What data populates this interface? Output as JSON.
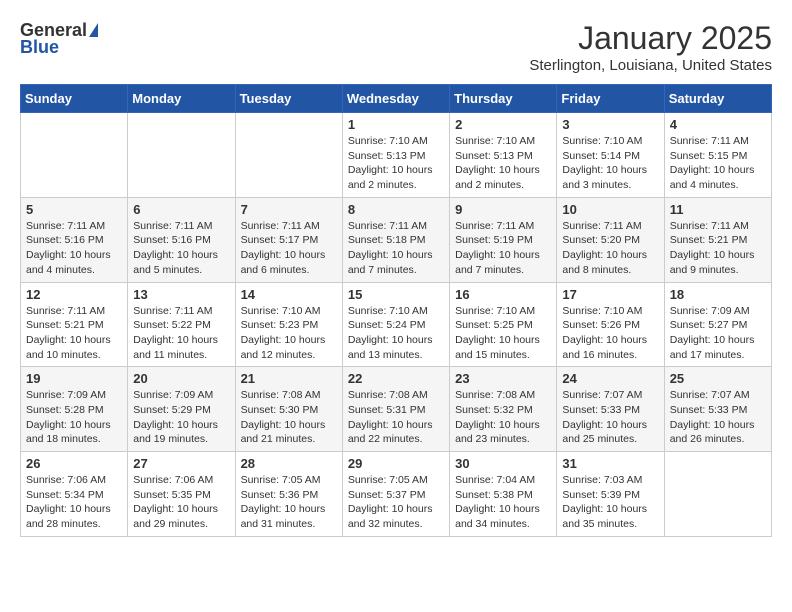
{
  "header": {
    "logo_general": "General",
    "logo_blue": "Blue",
    "month_title": "January 2025",
    "location": "Sterlington, Louisiana, United States"
  },
  "days_of_week": [
    "Sunday",
    "Monday",
    "Tuesday",
    "Wednesday",
    "Thursday",
    "Friday",
    "Saturday"
  ],
  "weeks": [
    [
      {
        "day": "",
        "info": ""
      },
      {
        "day": "",
        "info": ""
      },
      {
        "day": "",
        "info": ""
      },
      {
        "day": "1",
        "info": "Sunrise: 7:10 AM\nSunset: 5:13 PM\nDaylight: 10 hours\nand 2 minutes."
      },
      {
        "day": "2",
        "info": "Sunrise: 7:10 AM\nSunset: 5:13 PM\nDaylight: 10 hours\nand 2 minutes."
      },
      {
        "day": "3",
        "info": "Sunrise: 7:10 AM\nSunset: 5:14 PM\nDaylight: 10 hours\nand 3 minutes."
      },
      {
        "day": "4",
        "info": "Sunrise: 7:11 AM\nSunset: 5:15 PM\nDaylight: 10 hours\nand 4 minutes."
      }
    ],
    [
      {
        "day": "5",
        "info": "Sunrise: 7:11 AM\nSunset: 5:16 PM\nDaylight: 10 hours\nand 4 minutes."
      },
      {
        "day": "6",
        "info": "Sunrise: 7:11 AM\nSunset: 5:16 PM\nDaylight: 10 hours\nand 5 minutes."
      },
      {
        "day": "7",
        "info": "Sunrise: 7:11 AM\nSunset: 5:17 PM\nDaylight: 10 hours\nand 6 minutes."
      },
      {
        "day": "8",
        "info": "Sunrise: 7:11 AM\nSunset: 5:18 PM\nDaylight: 10 hours\nand 7 minutes."
      },
      {
        "day": "9",
        "info": "Sunrise: 7:11 AM\nSunset: 5:19 PM\nDaylight: 10 hours\nand 7 minutes."
      },
      {
        "day": "10",
        "info": "Sunrise: 7:11 AM\nSunset: 5:20 PM\nDaylight: 10 hours\nand 8 minutes."
      },
      {
        "day": "11",
        "info": "Sunrise: 7:11 AM\nSunset: 5:21 PM\nDaylight: 10 hours\nand 9 minutes."
      }
    ],
    [
      {
        "day": "12",
        "info": "Sunrise: 7:11 AM\nSunset: 5:21 PM\nDaylight: 10 hours\nand 10 minutes."
      },
      {
        "day": "13",
        "info": "Sunrise: 7:11 AM\nSunset: 5:22 PM\nDaylight: 10 hours\nand 11 minutes."
      },
      {
        "day": "14",
        "info": "Sunrise: 7:10 AM\nSunset: 5:23 PM\nDaylight: 10 hours\nand 12 minutes."
      },
      {
        "day": "15",
        "info": "Sunrise: 7:10 AM\nSunset: 5:24 PM\nDaylight: 10 hours\nand 13 minutes."
      },
      {
        "day": "16",
        "info": "Sunrise: 7:10 AM\nSunset: 5:25 PM\nDaylight: 10 hours\nand 15 minutes."
      },
      {
        "day": "17",
        "info": "Sunrise: 7:10 AM\nSunset: 5:26 PM\nDaylight: 10 hours\nand 16 minutes."
      },
      {
        "day": "18",
        "info": "Sunrise: 7:09 AM\nSunset: 5:27 PM\nDaylight: 10 hours\nand 17 minutes."
      }
    ],
    [
      {
        "day": "19",
        "info": "Sunrise: 7:09 AM\nSunset: 5:28 PM\nDaylight: 10 hours\nand 18 minutes."
      },
      {
        "day": "20",
        "info": "Sunrise: 7:09 AM\nSunset: 5:29 PM\nDaylight: 10 hours\nand 19 minutes."
      },
      {
        "day": "21",
        "info": "Sunrise: 7:08 AM\nSunset: 5:30 PM\nDaylight: 10 hours\nand 21 minutes."
      },
      {
        "day": "22",
        "info": "Sunrise: 7:08 AM\nSunset: 5:31 PM\nDaylight: 10 hours\nand 22 minutes."
      },
      {
        "day": "23",
        "info": "Sunrise: 7:08 AM\nSunset: 5:32 PM\nDaylight: 10 hours\nand 23 minutes."
      },
      {
        "day": "24",
        "info": "Sunrise: 7:07 AM\nSunset: 5:33 PM\nDaylight: 10 hours\nand 25 minutes."
      },
      {
        "day": "25",
        "info": "Sunrise: 7:07 AM\nSunset: 5:33 PM\nDaylight: 10 hours\nand 26 minutes."
      }
    ],
    [
      {
        "day": "26",
        "info": "Sunrise: 7:06 AM\nSunset: 5:34 PM\nDaylight: 10 hours\nand 28 minutes."
      },
      {
        "day": "27",
        "info": "Sunrise: 7:06 AM\nSunset: 5:35 PM\nDaylight: 10 hours\nand 29 minutes."
      },
      {
        "day": "28",
        "info": "Sunrise: 7:05 AM\nSunset: 5:36 PM\nDaylight: 10 hours\nand 31 minutes."
      },
      {
        "day": "29",
        "info": "Sunrise: 7:05 AM\nSunset: 5:37 PM\nDaylight: 10 hours\nand 32 minutes."
      },
      {
        "day": "30",
        "info": "Sunrise: 7:04 AM\nSunset: 5:38 PM\nDaylight: 10 hours\nand 34 minutes."
      },
      {
        "day": "31",
        "info": "Sunrise: 7:03 AM\nSunset: 5:39 PM\nDaylight: 10 hours\nand 35 minutes."
      },
      {
        "day": "",
        "info": ""
      }
    ]
  ]
}
